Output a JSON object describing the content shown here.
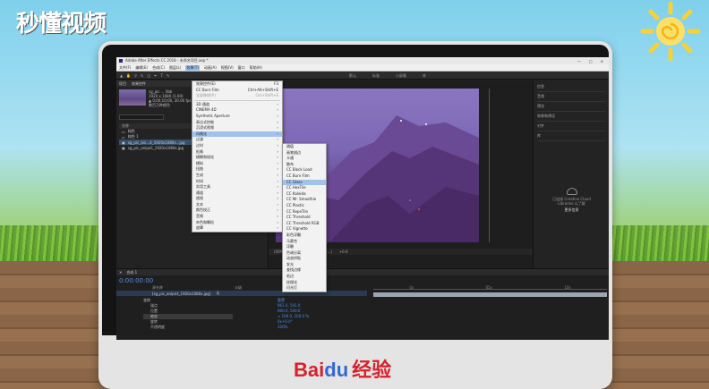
{
  "watermark": "秒懂视频",
  "brand": {
    "baidu": "Bai",
    "du": "du",
    "jingyan": "经验"
  },
  "app": {
    "title": "Adobe After Effects CC 2018 - 未命名项目.aep *",
    "window_controls": [
      "—",
      "□",
      "✕"
    ],
    "menubar": [
      "文件(F)",
      "编辑(E)",
      "合成(C)",
      "图层(L)",
      "效果(T)",
      "动画(A)",
      "视图(V)",
      "窗口",
      "帮助(H)"
    ],
    "active_menu_index": 4,
    "workspaces": [
      "默认",
      "标准",
      "小屏幕",
      "库"
    ]
  },
  "project": {
    "tabs": [
      "项目",
      "效果控件"
    ],
    "thumb_info": [
      "sg_pic ... 0bb",
      "1920 x 1080 (1.00)",
      "▲ 0;00;10;00, 30.00 fps",
      "数百万种颜色"
    ],
    "list_header": "名称",
    "files": [
      "纯色",
      "纯色 1",
      "sg_pic_ani...4_1920x1080s...jpg",
      "sg_pic_anipict_1920x1080s.jpg"
    ]
  },
  "effects_menu": {
    "items": [
      {
        "label": "效果控件(E)",
        "shortcut": "F3",
        "state": "normal"
      },
      {
        "label": "CC Burn Film",
        "shortcut": "Ctrl+Alt+Shift+E",
        "state": "normal"
      },
      {
        "label": "全部移除(R)",
        "shortcut": "Ctrl+Shift+E",
        "state": "disabled"
      },
      {
        "label": "3D 通道",
        "shortcut": "›",
        "state": "normal"
      },
      {
        "label": "CINEMA 4D",
        "shortcut": "›",
        "state": "normal"
      },
      {
        "label": "Synthetic Aperture",
        "shortcut": "›",
        "state": "normal"
      },
      {
        "label": "表达式控制",
        "shortcut": "›",
        "state": "normal"
      },
      {
        "label": "沉浸式视频",
        "shortcut": "›",
        "state": "normal"
      },
      {
        "label": "风格化",
        "shortcut": "›",
        "state": "selected"
      },
      {
        "label": "过渡",
        "shortcut": "›",
        "state": "normal"
      },
      {
        "label": "过时",
        "shortcut": "›",
        "state": "normal"
      },
      {
        "label": "抠像",
        "shortcut": "›",
        "state": "normal"
      },
      {
        "label": "模糊和锐化",
        "shortcut": "›",
        "state": "normal"
      },
      {
        "label": "模拟",
        "shortcut": "›",
        "state": "normal"
      },
      {
        "label": "扭曲",
        "shortcut": "›",
        "state": "normal"
      },
      {
        "label": "生成",
        "shortcut": "›",
        "state": "normal"
      },
      {
        "label": "时间",
        "shortcut": "›",
        "state": "normal"
      },
      {
        "label": "实用工具",
        "shortcut": "›",
        "state": "normal"
      },
      {
        "label": "通道",
        "shortcut": "›",
        "state": "normal"
      },
      {
        "label": "透视",
        "shortcut": "›",
        "state": "normal"
      },
      {
        "label": "文本",
        "shortcut": "›",
        "state": "normal"
      },
      {
        "label": "颜色校正",
        "shortcut": "›",
        "state": "normal"
      },
      {
        "label": "音频",
        "shortcut": "›",
        "state": "normal"
      },
      {
        "label": "杂色和颗粒",
        "shortcut": "›",
        "state": "normal"
      },
      {
        "label": "遮罩",
        "shortcut": "›",
        "state": "normal"
      }
    ]
  },
  "stylize_submenu": {
    "items": [
      "阈值",
      "画笔描边",
      "卡通",
      "散布",
      "CC Block Load",
      "CC Burn Film",
      "CC Glass",
      "CC HexTile",
      "CC Kaleida",
      "CC Mr. Smoothie",
      "CC Plastic",
      "CC RepeTile",
      "CC Threshold",
      "CC Threshold RGB",
      "CC Vignette",
      "彩色浮雕",
      "马赛克",
      "浮雕",
      "色调分离",
      "动态拼贴",
      "发光",
      "查找边缘",
      "毛边",
      "纹理化",
      "闪光灯"
    ],
    "selected_index": 6
  },
  "right_panel": {
    "items": [
      "信息",
      "音频",
      "预览",
      "效果和预设",
      "对齐",
      "库"
    ],
    "cloud_text": "已连接 Creative Cloud Libraries 以了解",
    "cloud_link": "更多信息"
  },
  "viewer": {
    "zoom": "(50%)",
    "timecode": "0;00;00;00",
    "quality": "(二分...)",
    "offset": "+0.0"
  },
  "timeline": {
    "tabs": [
      "合成 1"
    ],
    "timecode": "0:00:00:00",
    "columns": [
      "源名称",
      "父级"
    ],
    "layer_name": "[sg_pic_anipict_1920x1080s.jpg]",
    "layer_mode": "无",
    "props": [
      "变换",
      "锚点",
      "位置",
      "缩放",
      "旋转",
      "不透明度"
    ],
    "highlighted_prop": 3,
    "values": [
      "重置",
      "961.0, 541.0",
      "960.0, 540.0",
      "∞ 100.0, 100.0 %",
      "0x+0.0°",
      "100%"
    ],
    "ruler": [
      "0s",
      "05s",
      "10s"
    ]
  }
}
